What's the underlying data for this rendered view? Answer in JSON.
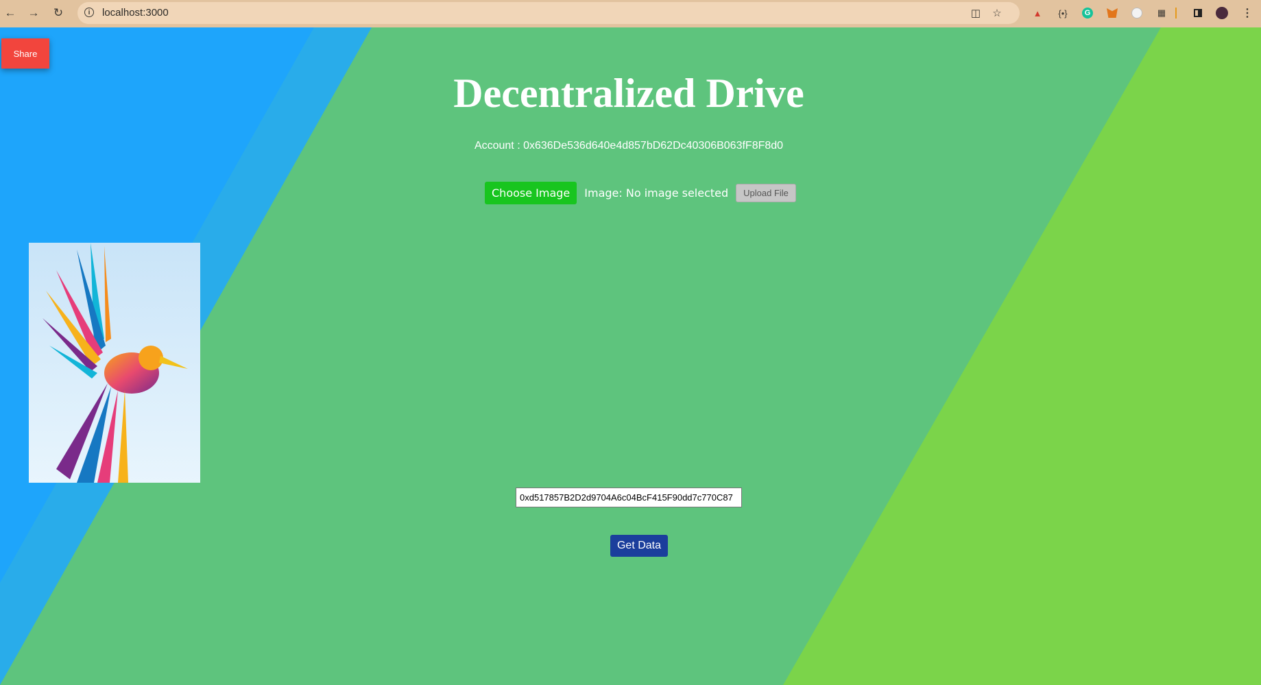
{
  "browser": {
    "url": "localhost:3000"
  },
  "page": {
    "share_label": "Share",
    "title": "Decentralized Drive",
    "account_text": "Account : 0x636De536d640e4d857bD62Dc40306B063fF8F8d0",
    "choose_image_label": "Choose Image",
    "image_status": "Image: No image selected",
    "upload_label": "Upload File",
    "address_value": "0xd517857B2D2d9704A6c04BcF415F90dd7c770C87",
    "get_data_label": "Get Data"
  },
  "colors": {
    "bg_blue": "#1ea5fb",
    "bg_blue_light": "#29acea",
    "bg_green": "#5ec47d",
    "bg_lime": "#7bd44a",
    "share_red": "#f2453d",
    "choose_green": "#18c51f",
    "get_data_blue": "#1b3e9c"
  }
}
